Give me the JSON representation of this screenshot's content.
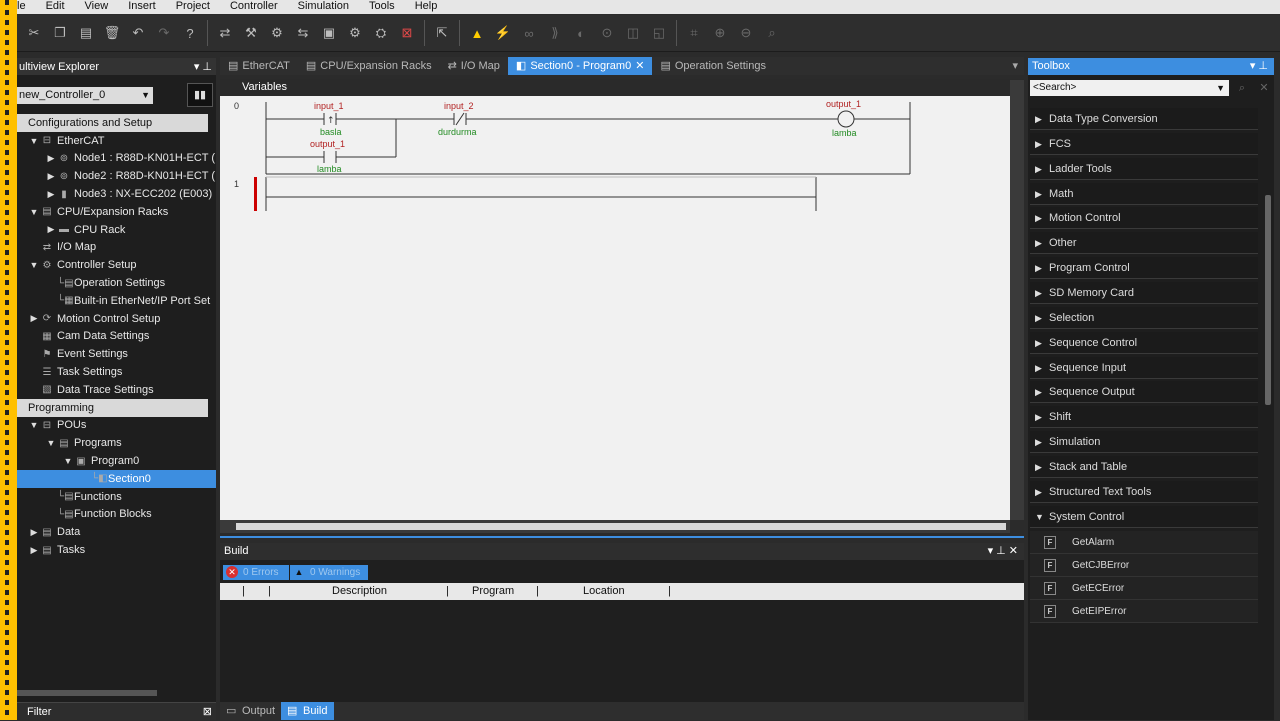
{
  "menu": [
    "le",
    "Edit",
    "View",
    "Insert",
    "Project",
    "Controller",
    "Simulation",
    "Tools",
    "Help"
  ],
  "left": {
    "header": "ultiview Explorer",
    "controller": "new_Controller_0",
    "tree": [
      {
        "label": "Configurations and Setup",
        "kind": "cat",
        "indent": 0
      },
      {
        "label": "EtherCAT",
        "ex": "▼",
        "icon": "ethercat-icon",
        "glyph": "⊟",
        "indent": 1
      },
      {
        "label": "Node1 : R88D-KN01H-ECT (",
        "ex": "▶",
        "icon": "servo-icon",
        "glyph": "⊚",
        "indent": 2
      },
      {
        "label": "Node2 : R88D-KN01H-ECT (",
        "ex": "▶",
        "icon": "servo-icon",
        "glyph": "⊚",
        "indent": 2
      },
      {
        "label": "Node3 : NX-ECC202 (E003)",
        "ex": "▶",
        "icon": "coupler-icon",
        "glyph": "▮",
        "indent": 2
      },
      {
        "label": "CPU/Expansion Racks",
        "ex": "▼",
        "icon": "rack-icon",
        "glyph": "▤",
        "indent": 1
      },
      {
        "label": "CPU Rack",
        "ex": "▶",
        "icon": "cpu-rack-icon",
        "glyph": "▬",
        "indent": 2
      },
      {
        "label": "I/O Map",
        "ex": "",
        "icon": "io-map-icon",
        "glyph": "⇄",
        "indent": 1
      },
      {
        "label": "Controller Setup",
        "ex": "▼",
        "icon": "controller-setup-icon",
        "glyph": "⚙",
        "indent": 1
      },
      {
        "label": "Operation Settings",
        "ex": "",
        "icon": "settings-icon",
        "glyph": "└▤",
        "indent": 2
      },
      {
        "label": "Built-in EtherNet/IP Port Set",
        "ex": "",
        "icon": "ethernet-icon",
        "glyph": "└▦",
        "indent": 2
      },
      {
        "label": "Motion Control Setup",
        "ex": "▶",
        "icon": "motion-icon",
        "glyph": "⟳",
        "indent": 1
      },
      {
        "label": "Cam Data Settings",
        "ex": "",
        "icon": "cam-icon",
        "glyph": "▦",
        "indent": 1
      },
      {
        "label": "Event Settings",
        "ex": "",
        "icon": "event-icon",
        "glyph": "⚑",
        "indent": 1
      },
      {
        "label": "Task Settings",
        "ex": "",
        "icon": "task-icon",
        "glyph": "☰",
        "indent": 1
      },
      {
        "label": "Data Trace Settings",
        "ex": "",
        "icon": "trace-icon",
        "glyph": "▧",
        "indent": 1
      },
      {
        "label": "Programming",
        "kind": "cat",
        "indent": 0
      },
      {
        "label": "POUs",
        "ex": "▼",
        "icon": "pou-icon",
        "glyph": "⊟",
        "indent": 1
      },
      {
        "label": "Programs",
        "ex": "▼",
        "icon": "programs-icon",
        "glyph": "▤",
        "indent": 2
      },
      {
        "label": "Program0",
        "ex": "▼",
        "icon": "program-icon",
        "glyph": "▣",
        "indent": 3
      },
      {
        "label": "Section0",
        "ex": "",
        "icon": "section-icon",
        "glyph": "└◧",
        "indent": 4,
        "selected": true
      },
      {
        "label": "Functions",
        "ex": "",
        "icon": "functions-icon",
        "glyph": "└▤",
        "indent": 2
      },
      {
        "label": "Function Blocks",
        "ex": "",
        "icon": "function-blocks-icon",
        "glyph": "└▤",
        "indent": 2
      },
      {
        "label": "Data",
        "ex": "▶",
        "icon": "data-icon",
        "glyph": "▤",
        "indent": 1
      },
      {
        "label": "Tasks",
        "ex": "▶",
        "icon": "tasks-icon",
        "glyph": "▤",
        "indent": 1
      }
    ],
    "filter": "Filter"
  },
  "tabs": [
    {
      "label": "EtherCAT",
      "icon": "ethercat-icon"
    },
    {
      "label": "CPU/Expansion Racks",
      "icon": "rack-icon"
    },
    {
      "label": "I/O Map",
      "icon": "io-map-icon"
    },
    {
      "label": "Section0 - Program0",
      "icon": "section-icon",
      "active": true,
      "close": "✕"
    },
    {
      "label": "Operation Settings",
      "icon": "settings-icon"
    }
  ],
  "editor": {
    "variables": "Variables",
    "rungs": [
      "0",
      "1"
    ],
    "contacts": [
      {
        "name": "input_1",
        "type": "rising",
        "sub": "basla"
      },
      {
        "name": "input_2",
        "type": "nc",
        "sub": "durdurma"
      },
      {
        "name": "output_1",
        "type": "no",
        "sub": "lamba"
      }
    ],
    "coil": {
      "name": "output_1",
      "sub": "lamba"
    }
  },
  "build": {
    "title": "Build",
    "errors": "0   Errors",
    "warnings": "0   Warnings",
    "columns": [
      "Description",
      "Program",
      "Location"
    ],
    "tabs": [
      "Output",
      "Build"
    ]
  },
  "toolbox": {
    "title": "Toolbox",
    "search": "<Search>",
    "categories": [
      "Data Type Conversion",
      "FCS",
      "Ladder Tools",
      "Math",
      "Motion Control",
      "Other",
      "Program Control",
      "SD Memory Card",
      "Selection",
      "Sequence Control",
      "Sequence Input",
      "Sequence Output",
      "Shift",
      "Simulation",
      "Stack and Table",
      "Structured Text Tools",
      "System Control"
    ],
    "functions": [
      "GetAlarm",
      "GetCJBError",
      "GetECError",
      "GetEIPError"
    ],
    "fn_badge": "F"
  },
  "colors": {
    "accent": "#3d8ee0",
    "stripe": "#ffc000",
    "panel": "#1e1e1e"
  }
}
